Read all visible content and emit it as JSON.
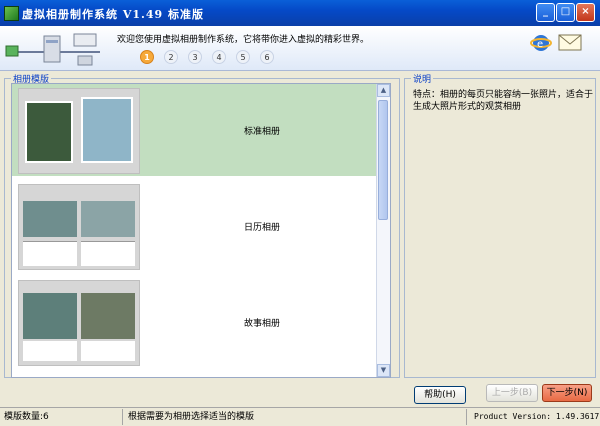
{
  "window": {
    "title": "虚拟相册制作系统 V1.49  标准版",
    "buttons": [
      "_",
      "□",
      "×"
    ]
  },
  "header": {
    "welcome": "欢迎您使用虚拟相册制作系统，它将带你进入虚拟的精彩世界。",
    "steps": [
      "1",
      "2",
      "3",
      "4",
      "5",
      "6"
    ],
    "active_step": 1
  },
  "templates": {
    "legend": "相册模版",
    "items": [
      {
        "label": "标准相册",
        "selected": true
      },
      {
        "label": "日历相册",
        "selected": false
      },
      {
        "label": "故事相册",
        "selected": false
      }
    ]
  },
  "description": {
    "legend": "说明",
    "text": "特点：相册的每页只能容纳一张照片，适合于生成大照片形式的观赏相册"
  },
  "buttons": {
    "help": "帮助(H)",
    "prev": "上一步(B)",
    "next": "下一步(N)"
  },
  "status": {
    "count": "模版数量:6",
    "hint": "根据需要为相册选择适当的模版",
    "version": "Product Version:  1.49.3617"
  },
  "colors": {
    "selected_row": "#c2dec0",
    "active_step": "#f6a93a",
    "next_button": "#e86a44"
  }
}
